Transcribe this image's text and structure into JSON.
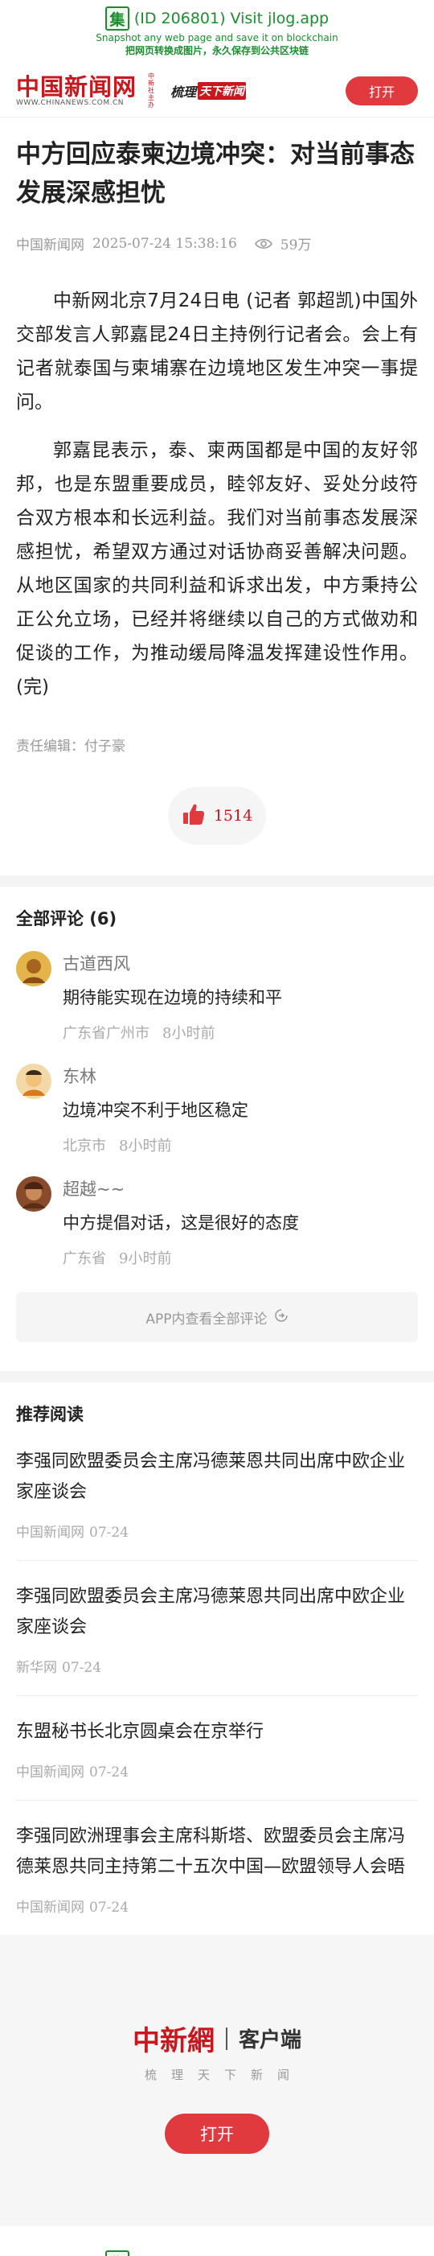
{
  "jlog": {
    "logo_char": "集",
    "title": "(ID 206801) Visit jlog.app",
    "subtitle": "Snapshot any web page and save it on blockchain",
    "subtitle_cn": "把网页转换成图片，永久保存到公共区块链"
  },
  "header": {
    "logo_cn": "中国新闻网",
    "logo_en": "WWW.CHINANEWS.COM.CN",
    "logo_vertical": "中新社主办",
    "slogan_a": "梳理",
    "slogan_b": "天下新闻",
    "open_label": "打开"
  },
  "article": {
    "title": "中方回应泰柬边境冲突：对当前事态发展深感担忧",
    "source": "中国新闻网",
    "datetime": "2025-07-24 15:38:16",
    "views": "59万",
    "paragraphs": [
      "中新网北京7月24日电 (记者 郭超凯)中国外交部发言人郭嘉昆24日主持例行记者会。会上有记者就泰国与柬埔寨在边境地区发生冲突一事提问。",
      "郭嘉昆表示，泰、柬两国都是中国的友好邻邦，也是东盟重要成员，睦邻友好、妥处分歧符合双方根本和长远利益。我们对当前事态发展深感担忧，希望双方通过对话协商妥善解决问题。从地区国家的共同利益和诉求出发，中方秉持公正公允立场，已经并将继续以自己的方式做劝和促谈的工作，为推动缓局降温发挥建设性作用。(完)"
    ],
    "editor": "责任编辑：付子豪",
    "likes": "1514"
  },
  "comments": {
    "title": "全部评论 (6)",
    "items": [
      {
        "name": "古道西风",
        "text": "期待能实现在边境的持续和平",
        "location": "广东省广州市",
        "time": "8小时前"
      },
      {
        "name": "东林",
        "text": "边境冲突不利于地区稳定",
        "location": "北京市",
        "time": "8小时前"
      },
      {
        "name": "超越~~",
        "text": "中方提倡对话，这是很好的态度",
        "location": "广东省",
        "time": "9小时前"
      }
    ],
    "view_all": "APP内查看全部评论"
  },
  "recommend": {
    "title": "推荐阅读",
    "items": [
      {
        "title": "李强同欧盟委员会主席冯德莱恩共同出席中欧企业家座谈会",
        "source": "中国新闻网",
        "date": "07-24"
      },
      {
        "title": "李强同欧盟委员会主席冯德莱恩共同出席中欧企业家座谈会",
        "source": "新华网",
        "date": "07-24"
      },
      {
        "title": "东盟秘书长北京圆桌会在京举行",
        "source": "中国新闻网",
        "date": "07-24"
      },
      {
        "title": "李强同欧洲理事会主席科斯塔、欧盟委员会主席冯德莱恩共同主持第二十五次中国—欧盟领导人会晤",
        "source": "中国新闻网",
        "date": "07-24"
      }
    ]
  },
  "footer": {
    "logo_cn": "中新網",
    "label": "客户端",
    "slogan": "梳理天下新闻",
    "open_label": "打开"
  },
  "colors": {
    "brand_red": "#c8171d",
    "button_red": "#e0393e",
    "jlog_green": "#1a8d2e"
  }
}
